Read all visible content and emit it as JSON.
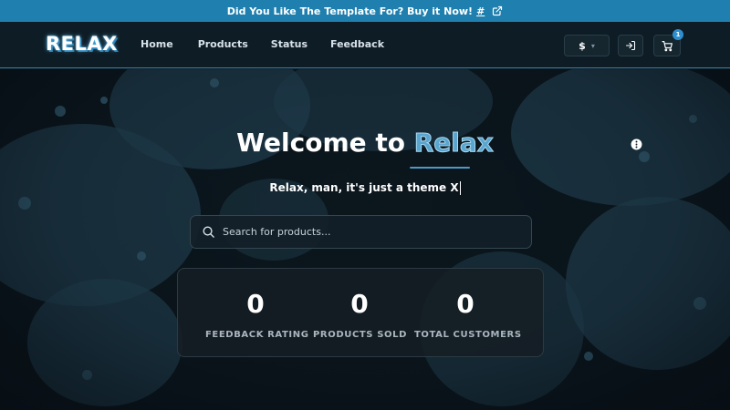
{
  "announcement": {
    "text": "Did You Like The Template For? Buy it Now!",
    "link": "#",
    "link_icon": "external-link-icon"
  },
  "header": {
    "logo": "RELAX",
    "nav": [
      {
        "label": "Home"
      },
      {
        "label": "Products"
      },
      {
        "label": "Status"
      },
      {
        "label": "Feedback"
      }
    ],
    "currency": "$",
    "login_icon": "login-icon",
    "cart_icon": "cart-icon",
    "cart_count": "1"
  },
  "hero": {
    "title_prefix": "Welcome to",
    "title_accent": "Relax",
    "subtitle": "Relax, man, it's just a theme X",
    "info_icon": "info-icon"
  },
  "search": {
    "placeholder": "Search for products...",
    "value": ""
  },
  "stats": [
    {
      "value": "0",
      "label": "FEEDBACK RATING"
    },
    {
      "value": "0",
      "label": "PRODUCTS SOLD"
    },
    {
      "value": "0",
      "label": "TOTAL CUSTOMERS"
    }
  ],
  "colors": {
    "accent": "#1f7fae",
    "brand_blue": "#5aa5cf",
    "background": "#0d1b24"
  }
}
